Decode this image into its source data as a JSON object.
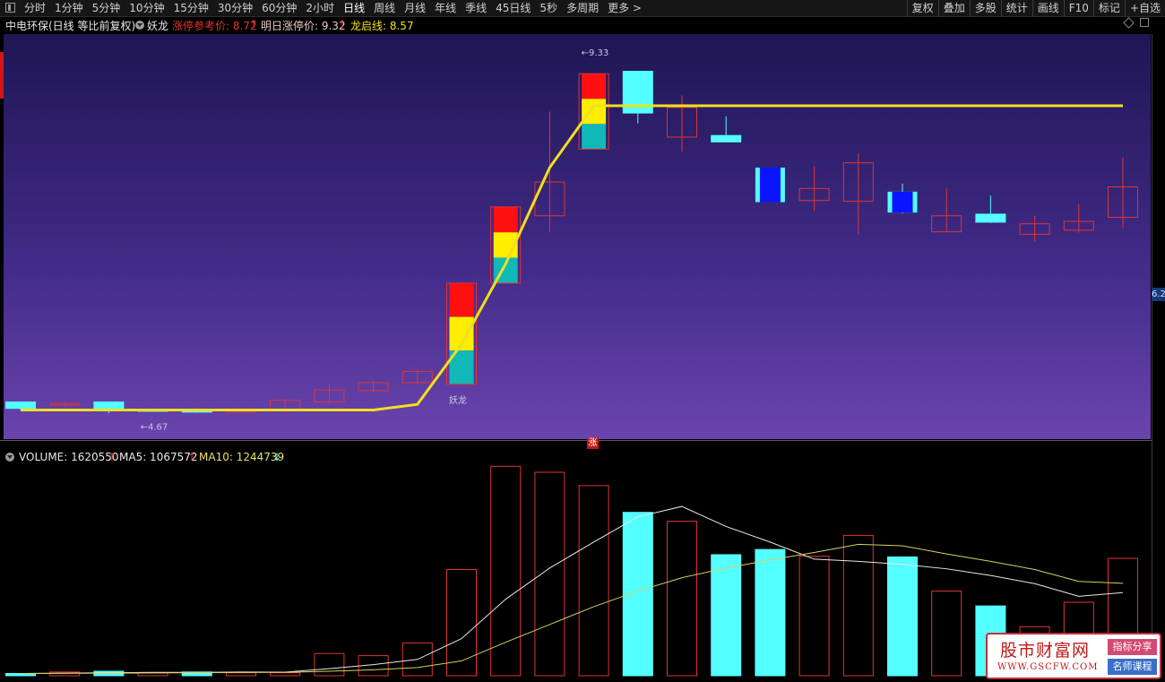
{
  "toolbar": {
    "left_items": [
      "分时",
      "1分钟",
      "5分钟",
      "10分钟",
      "15分钟",
      "30分钟",
      "60分钟",
      "2小时",
      "日线",
      "周线",
      "月线",
      "年线",
      "季线",
      "45日线",
      "5秒",
      "多周期",
      "更多 >"
    ],
    "active_item": "日线",
    "right_items": [
      "复权",
      "叠加",
      "多股",
      "统计",
      "画线",
      "F10",
      "标记",
      "+自选"
    ]
  },
  "info": {
    "stock_name": "中电环保(日线 等比前复权)",
    "indicator": "妖龙",
    "limit_ref_label": "涨停参考价: 8.72",
    "limit_ref_arrow": "↑",
    "next_limit_label": "明日涨停价: 9.32",
    "next_limit_arrow": "↑",
    "dragon_label": "龙启线: 8.57"
  },
  "colors": {
    "up": "#e03434",
    "down": "#54ffff",
    "down_strong": "#0a14ff",
    "dragon_line": "#f0e020",
    "ma5": "#e8e8e8",
    "ma10": "#d8d060",
    "stack_red": "#ff1010",
    "stack_yellow": "#ffee00",
    "stack_teal": "#10b8b8"
  },
  "chart_data": [
    {
      "type": "candlestick",
      "title": "中电环保(日线 等比前复权)",
      "price_marker": "6.2",
      "bars": [
        {
          "o": 4.88,
          "h": 4.88,
          "l": 4.78,
          "c": 4.8,
          "dir": "down"
        },
        {
          "o": 4.84,
          "h": 4.86,
          "l": 4.82,
          "c": 4.86,
          "dir": "up"
        },
        {
          "o": 4.88,
          "h": 4.88,
          "l": 4.74,
          "c": 4.79,
          "dir": "down"
        },
        {
          "o": 4.78,
          "h": 4.78,
          "l": 4.76,
          "c": 4.77,
          "dir": "doji"
        },
        {
          "o": 4.77,
          "h": 4.8,
          "l": 4.75,
          "c": 4.76,
          "dir": "down"
        },
        {
          "o": 4.76,
          "h": 4.79,
          "l": 4.74,
          "c": 4.77,
          "dir": "up"
        },
        {
          "o": 4.77,
          "h": 4.92,
          "l": 4.75,
          "c": 4.9,
          "dir": "up"
        },
        {
          "o": 4.88,
          "h": 5.1,
          "l": 4.85,
          "c": 5.03,
          "dir": "up"
        },
        {
          "o": 5.02,
          "h": 5.14,
          "l": 5.0,
          "c": 5.12,
          "dir": "up"
        },
        {
          "o": 5.12,
          "h": 5.29,
          "l": 5.1,
          "c": 5.26,
          "dir": "up"
        },
        {
          "o": 5.1,
          "h": 6.36,
          "l": 5.1,
          "c": 6.36,
          "dir": "up",
          "dragon": true
        },
        {
          "o": 6.36,
          "h": 7.31,
          "l": 6.36,
          "c": 7.31,
          "dir": "up",
          "dragon": true
        },
        {
          "o": 7.2,
          "h": 8.5,
          "l": 7.0,
          "c": 7.62,
          "dir": "up"
        },
        {
          "o": 8.03,
          "h": 8.97,
          "l": 8.03,
          "c": 8.97,
          "dir": "up",
          "dragon": true
        },
        {
          "o": 9.0,
          "h": 9.0,
          "l": 8.35,
          "c": 8.48,
          "dir": "down"
        },
        {
          "o": 8.18,
          "h": 8.7,
          "l": 8.0,
          "c": 8.55,
          "dir": "up"
        },
        {
          "o": 8.2,
          "h": 8.44,
          "l": 8.14,
          "c": 8.12,
          "dir": "down"
        },
        {
          "o": 7.8,
          "h": 7.8,
          "l": 7.38,
          "c": 7.37,
          "dir": "down_strong"
        },
        {
          "o": 7.39,
          "h": 7.82,
          "l": 7.26,
          "c": 7.54,
          "dir": "up"
        },
        {
          "o": 7.38,
          "h": 7.98,
          "l": 6.97,
          "c": 7.86,
          "dir": "up"
        },
        {
          "o": 7.5,
          "h": 7.6,
          "l": 7.23,
          "c": 7.24,
          "dir": "down_strong"
        },
        {
          "o": 7.0,
          "h": 7.54,
          "l": 7.0,
          "c": 7.2,
          "dir": "up"
        },
        {
          "o": 7.22,
          "h": 7.45,
          "l": 7.11,
          "c": 7.12,
          "dir": "down"
        },
        {
          "o": 6.97,
          "h": 7.2,
          "l": 6.88,
          "c": 7.1,
          "dir": "up"
        },
        {
          "o": 7.02,
          "h": 7.35,
          "l": 6.99,
          "c": 7.13,
          "dir": "up"
        },
        {
          "o": 7.18,
          "h": 7.93,
          "l": 7.05,
          "c": 7.56,
          "dir": "up"
        }
      ],
      "dragon_line": [
        4.78,
        4.78,
        4.78,
        4.78,
        4.78,
        4.78,
        4.78,
        4.78,
        4.78,
        4.85,
        5.6,
        6.6,
        7.8,
        8.57,
        8.57,
        8.57,
        8.57,
        8.57,
        8.57,
        8.57,
        8.57,
        8.57,
        8.57,
        8.57,
        8.57,
        8.57
      ],
      "annotations": [
        {
          "text": "←4.67",
          "bar": 3,
          "price": 4.67
        },
        {
          "text": "←9.33",
          "bar": 13,
          "price": 9.33
        },
        {
          "text": "妖龙",
          "bar": 10,
          "price": 5.0
        }
      ]
    },
    {
      "type": "volume",
      "volume_label": "VOLUME: 1620550",
      "volume_arrow": "↑",
      "ma5_label": "MA5: 1067572",
      "ma5_arrow": "↑",
      "ma10_label": "MA10: 1244739",
      "ma10_arrow": "↓",
      "ylim": [
        0,
        2800000
      ],
      "volumes": [
        30000,
        50000,
        60000,
        40000,
        50000,
        40000,
        40000,
        300000,
        270000,
        440000,
        1430000,
        2820000,
        2740000,
        2560000,
        2200000,
        2080000,
        1630000,
        1700000,
        1610000,
        1890000,
        1600000,
        1140000,
        940000,
        660000,
        990000,
        1580000
      ],
      "dirs": [
        "down",
        "up",
        "down",
        "up",
        "down",
        "up",
        "up",
        "up",
        "up",
        "up",
        "up",
        "up",
        "up",
        "up",
        "down",
        "up",
        "down",
        "down",
        "up",
        "up",
        "down",
        "up",
        "down",
        "up",
        "up",
        "up"
      ],
      "ma5": [
        30000,
        35000,
        40000,
        45000,
        45000,
        50000,
        48000,
        95000,
        150000,
        220000,
        500000,
        1030000,
        1450000,
        1800000,
        2140000,
        2280000,
        2010000,
        1800000,
        1570000,
        1540000,
        1500000,
        1440000,
        1350000,
        1240000,
        1070000,
        1120000
      ],
      "ma10": [
        30000,
        32000,
        35000,
        38000,
        40000,
        43000,
        45000,
        60000,
        80000,
        110000,
        200000,
        450000,
        690000,
        930000,
        1140000,
        1320000,
        1450000,
        1560000,
        1660000,
        1770000,
        1750000,
        1640000,
        1540000,
        1430000,
        1270000,
        1245000
      ]
    }
  ],
  "watermark": {
    "site_name": "股市财富网",
    "url": "WWW.GSCFW.COM",
    "tag1": "指标分享",
    "tag2": "名师课程"
  }
}
